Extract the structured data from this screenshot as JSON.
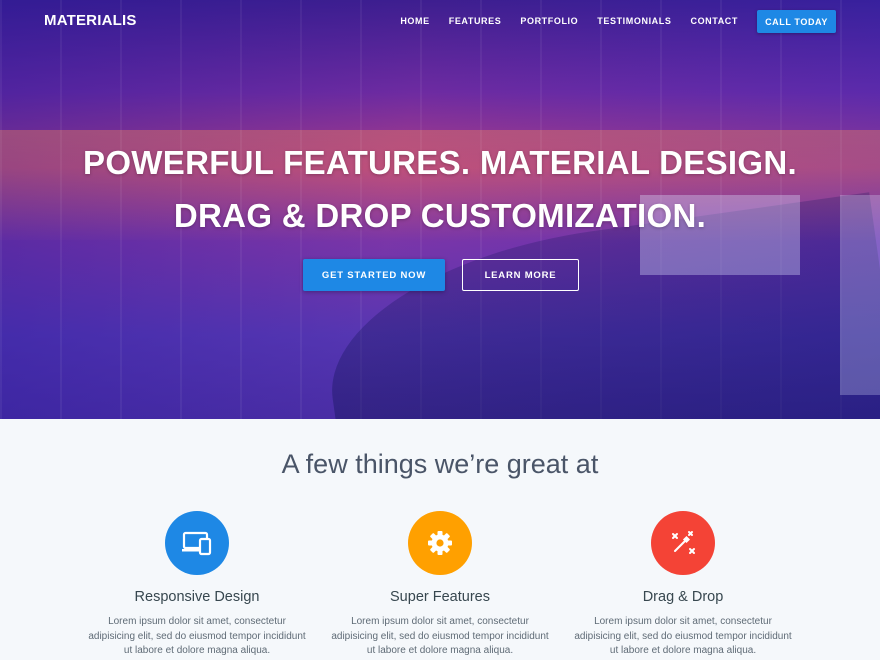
{
  "brand": {
    "logo": "MATERIALIS"
  },
  "nav": {
    "items": [
      "HOME",
      "FEATURES",
      "PORTFOLIO",
      "TESTIMONIALS",
      "CONTACT"
    ],
    "cta": "CALL TODAY"
  },
  "hero": {
    "line1": "POWERFUL FEATURES. MATERIAL DESIGN.",
    "line2": "DRAG & DROP CUSTOMIZATION.",
    "primary_button": "GET STARTED NOW",
    "secondary_button": "LEARN MORE"
  },
  "features": {
    "title": "A few things we’re great at",
    "items": [
      {
        "icon": "responsive-devices-icon",
        "color": "#1e88e5",
        "title": "Responsive Design",
        "text": "Lorem ipsum dolor sit amet, consectetur adipisicing elit, sed do eiusmod tempor incididunt ut labore et dolore magna aliqua."
      },
      {
        "icon": "gear-icon",
        "color": "#ffa000",
        "title": "Super Features",
        "text": "Lorem ipsum dolor sit amet, consectetur adipisicing elit, sed do eiusmod tempor incididunt ut labore et dolore magna aliqua."
      },
      {
        "icon": "magic-wand-icon",
        "color": "#f44336",
        "title": "Drag & Drop",
        "text": "Lorem ipsum dolor sit amet, consectetur adipisicing elit, sed do eiusmod tempor incididunt ut labore et dolore magna aliqua."
      }
    ]
  },
  "colors": {
    "accent": "#1e88e5",
    "heading": "#4a5568"
  }
}
